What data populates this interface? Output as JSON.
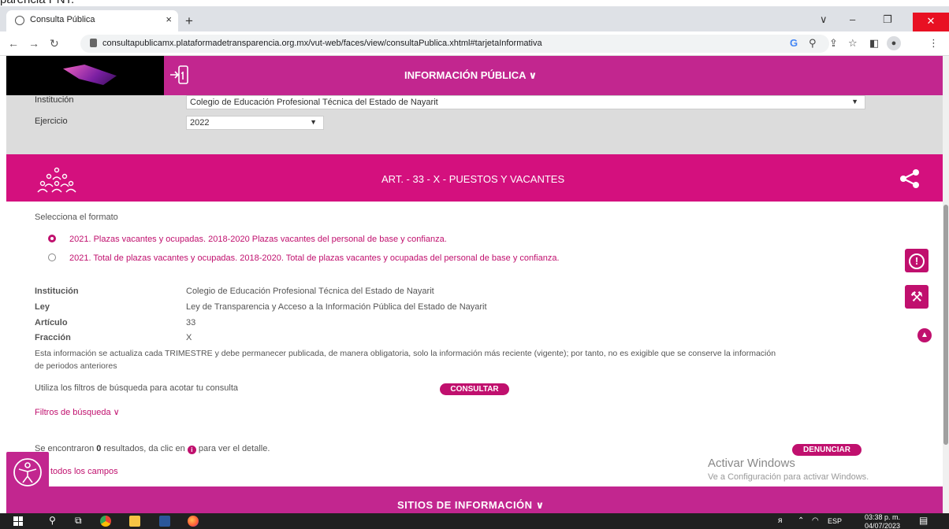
{
  "caption": "parencia PNT.",
  "browser": {
    "tab_title": "Consulta Pública",
    "tab_close": "×",
    "new_tab": "+",
    "url": "consultapublicamx.plataformadetransparencia.org.mx/vut-web/faces/view/consultaPublica.xhtml#tarjetaInformativa",
    "min": "–",
    "restore": "❐",
    "close": "✕",
    "chevron": "∨"
  },
  "header": {
    "title": "INFORMACIÓN PÚBLICA ∨"
  },
  "filters": {
    "institucion_label": "Institución",
    "institucion_value": "Colegio de Educación Profesional Técnica del Estado de Nayarit",
    "ejercicio_label": "Ejercicio",
    "ejercicio_value": "2022"
  },
  "banner": {
    "title": "ART. - 33 - X - PUESTOS Y VACANTES"
  },
  "formato": {
    "label": "Selecciona el formato",
    "options": [
      {
        "label": "2021. Plazas vacantes y ocupadas. 2018-2020 Plazas vacantes del personal de base y confianza.",
        "selected": true
      },
      {
        "label": "2021. Total de plazas vacantes y ocupadas. 2018-2020. Total de plazas vacantes y ocupadas del personal de base y confianza.",
        "selected": false
      }
    ]
  },
  "info": {
    "rows": [
      {
        "label": "Institución",
        "value": "Colegio de Educación Profesional Técnica del Estado de Nayarit"
      },
      {
        "label": "Ley",
        "value": "Ley de Transparencia y Acceso a la Información Pública del Estado de Nayarit"
      },
      {
        "label": "Artículo",
        "value": "33"
      },
      {
        "label": "Fracción",
        "value": "X"
      }
    ],
    "note_line1": "Esta información se actualiza cada TRIMESTRE y debe permanecer publicada, de manera obligatoria, solo la información más reciente (vigente); por tanto, no es exigible que se conserve la información",
    "note_line2": "de periodos anteriores"
  },
  "search": {
    "hint": "Utiliza los filtros de búsqueda para acotar tu consulta",
    "consultar": "CONSULTAR",
    "filtros_link": "Filtros de búsqueda ∨"
  },
  "results": {
    "prefix": "Se encontraron ",
    "count": "0",
    "suffix_a": " resultados, da clic en ",
    "suffix_b": " para ver el detalle.",
    "denunciar": "DENUNCIAR",
    "todos": "todos los campos"
  },
  "side": {
    "alert": "!",
    "tool": "⚒",
    "up": "▲"
  },
  "windows": {
    "activate_title": "Activar Windows",
    "activate_sub": "Ve a Configuración para activar Windows."
  },
  "footer": {
    "title": "SITIOS DE INFORMACIÓN ∨"
  },
  "taskbar": {
    "lang": "ESP",
    "time": "03:38 p. m.",
    "date": "04/07/2023"
  }
}
